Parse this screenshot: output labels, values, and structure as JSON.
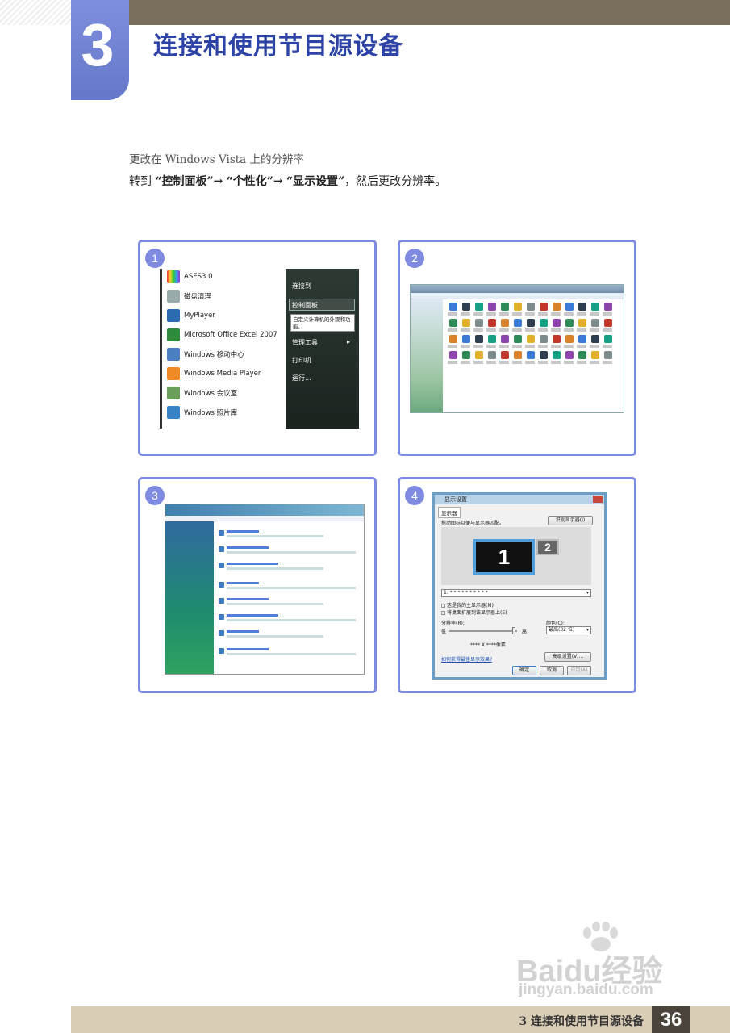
{
  "header": {
    "chapter_number": "3",
    "chapter_title": "连接和使用节目源设备"
  },
  "section": {
    "subtitle": "更改在 Windows Vista 上的分辨率",
    "instruction_prefix": "转到",
    "step1": "“控制面板”",
    "arrow": "→",
    "step2": "“个性化”",
    "step3": "“显示设置”",
    "instruction_suffix": "，然后更改分辨率。"
  },
  "panels": [
    {
      "number": "1"
    },
    {
      "number": "2"
    },
    {
      "number": "3"
    },
    {
      "number": "4"
    }
  ],
  "start_menu": {
    "left_items": [
      "ASES3.0",
      "磁盘清理",
      "MyPlayer",
      "Microsoft Office Excel 2007",
      "Windows 移动中心",
      "Windows Media Player",
      "Windows 会议室",
      "Windows 照片库"
    ],
    "right_items": [
      "连接到",
      "控制面板",
      "管理工具",
      "打印机",
      "运行..."
    ],
    "tooltip": "自定义计算机的外观和功能。"
  },
  "display_settings": {
    "title": "显示设置",
    "tab": "显示器",
    "prompt": "拖动图标以便与显示器匹配。",
    "identify_button": "识别显示器(I)",
    "monitor1": "1",
    "monitor2": "2",
    "monitor_select": "1. * * * * * * * * * *",
    "check1": "这是我的主显示器(M)",
    "check2": "将桌面扩展到该显示器上(E)",
    "resolution_label": "分辨率(R):",
    "low": "低",
    "high": "高",
    "color_label": "颜色(C):",
    "color_value": "最高(32 位)",
    "resolution_value": "**** X ****像素",
    "help_link": "如何获得最佳显示效果?",
    "advanced_button": "高级设置(V)...",
    "ok_button": "确定",
    "cancel_button": "取消",
    "apply_button": "应用(A)"
  },
  "footer": {
    "chapter_label": "3 连接和使用节目源设备",
    "page_number": "36"
  },
  "watermark": {
    "brand": "Baidu经验",
    "url": "jingyan.baidu.com"
  }
}
